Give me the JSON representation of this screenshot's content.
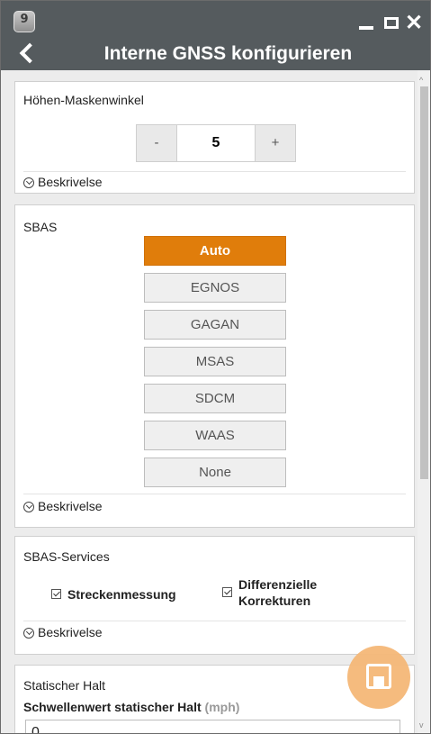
{
  "window": {
    "badge": "9",
    "title": "Interne GNSS konfigurieren"
  },
  "elevation": {
    "title": "Höhen-Maskenwinkel",
    "minus": "-",
    "value": "5",
    "plus": "+",
    "description": "Beskrivelse"
  },
  "sbas": {
    "title": "SBAS",
    "options": [
      "Auto",
      "EGNOS",
      "GAGAN",
      "MSAS",
      "SDCM",
      "WAAS",
      "None"
    ],
    "selected": "Auto",
    "description": "Beskrivelse"
  },
  "services": {
    "title": "SBAS-Services",
    "checkbox1": "Streckenmessung",
    "checkbox1_checked": true,
    "checkbox2": "Differenzielle\nKorrekturen",
    "checkbox2_checked": true,
    "description": "Beskrivelse"
  },
  "static_stop": {
    "title": "Statischer Halt",
    "field_label": "Schwellenwert statischer Halt",
    "field_unit": "(mph)",
    "field_value": "0"
  },
  "colors": {
    "titlebar": "#555b5e",
    "accent": "#e07d0b",
    "fab": "#f5b878"
  },
  "icons": [
    "app-badge-icon",
    "minimize-icon",
    "maximize-icon",
    "close-icon",
    "back-arrow-icon",
    "expand-circle-icon",
    "checkbox-icon",
    "save-disk-icon"
  ]
}
